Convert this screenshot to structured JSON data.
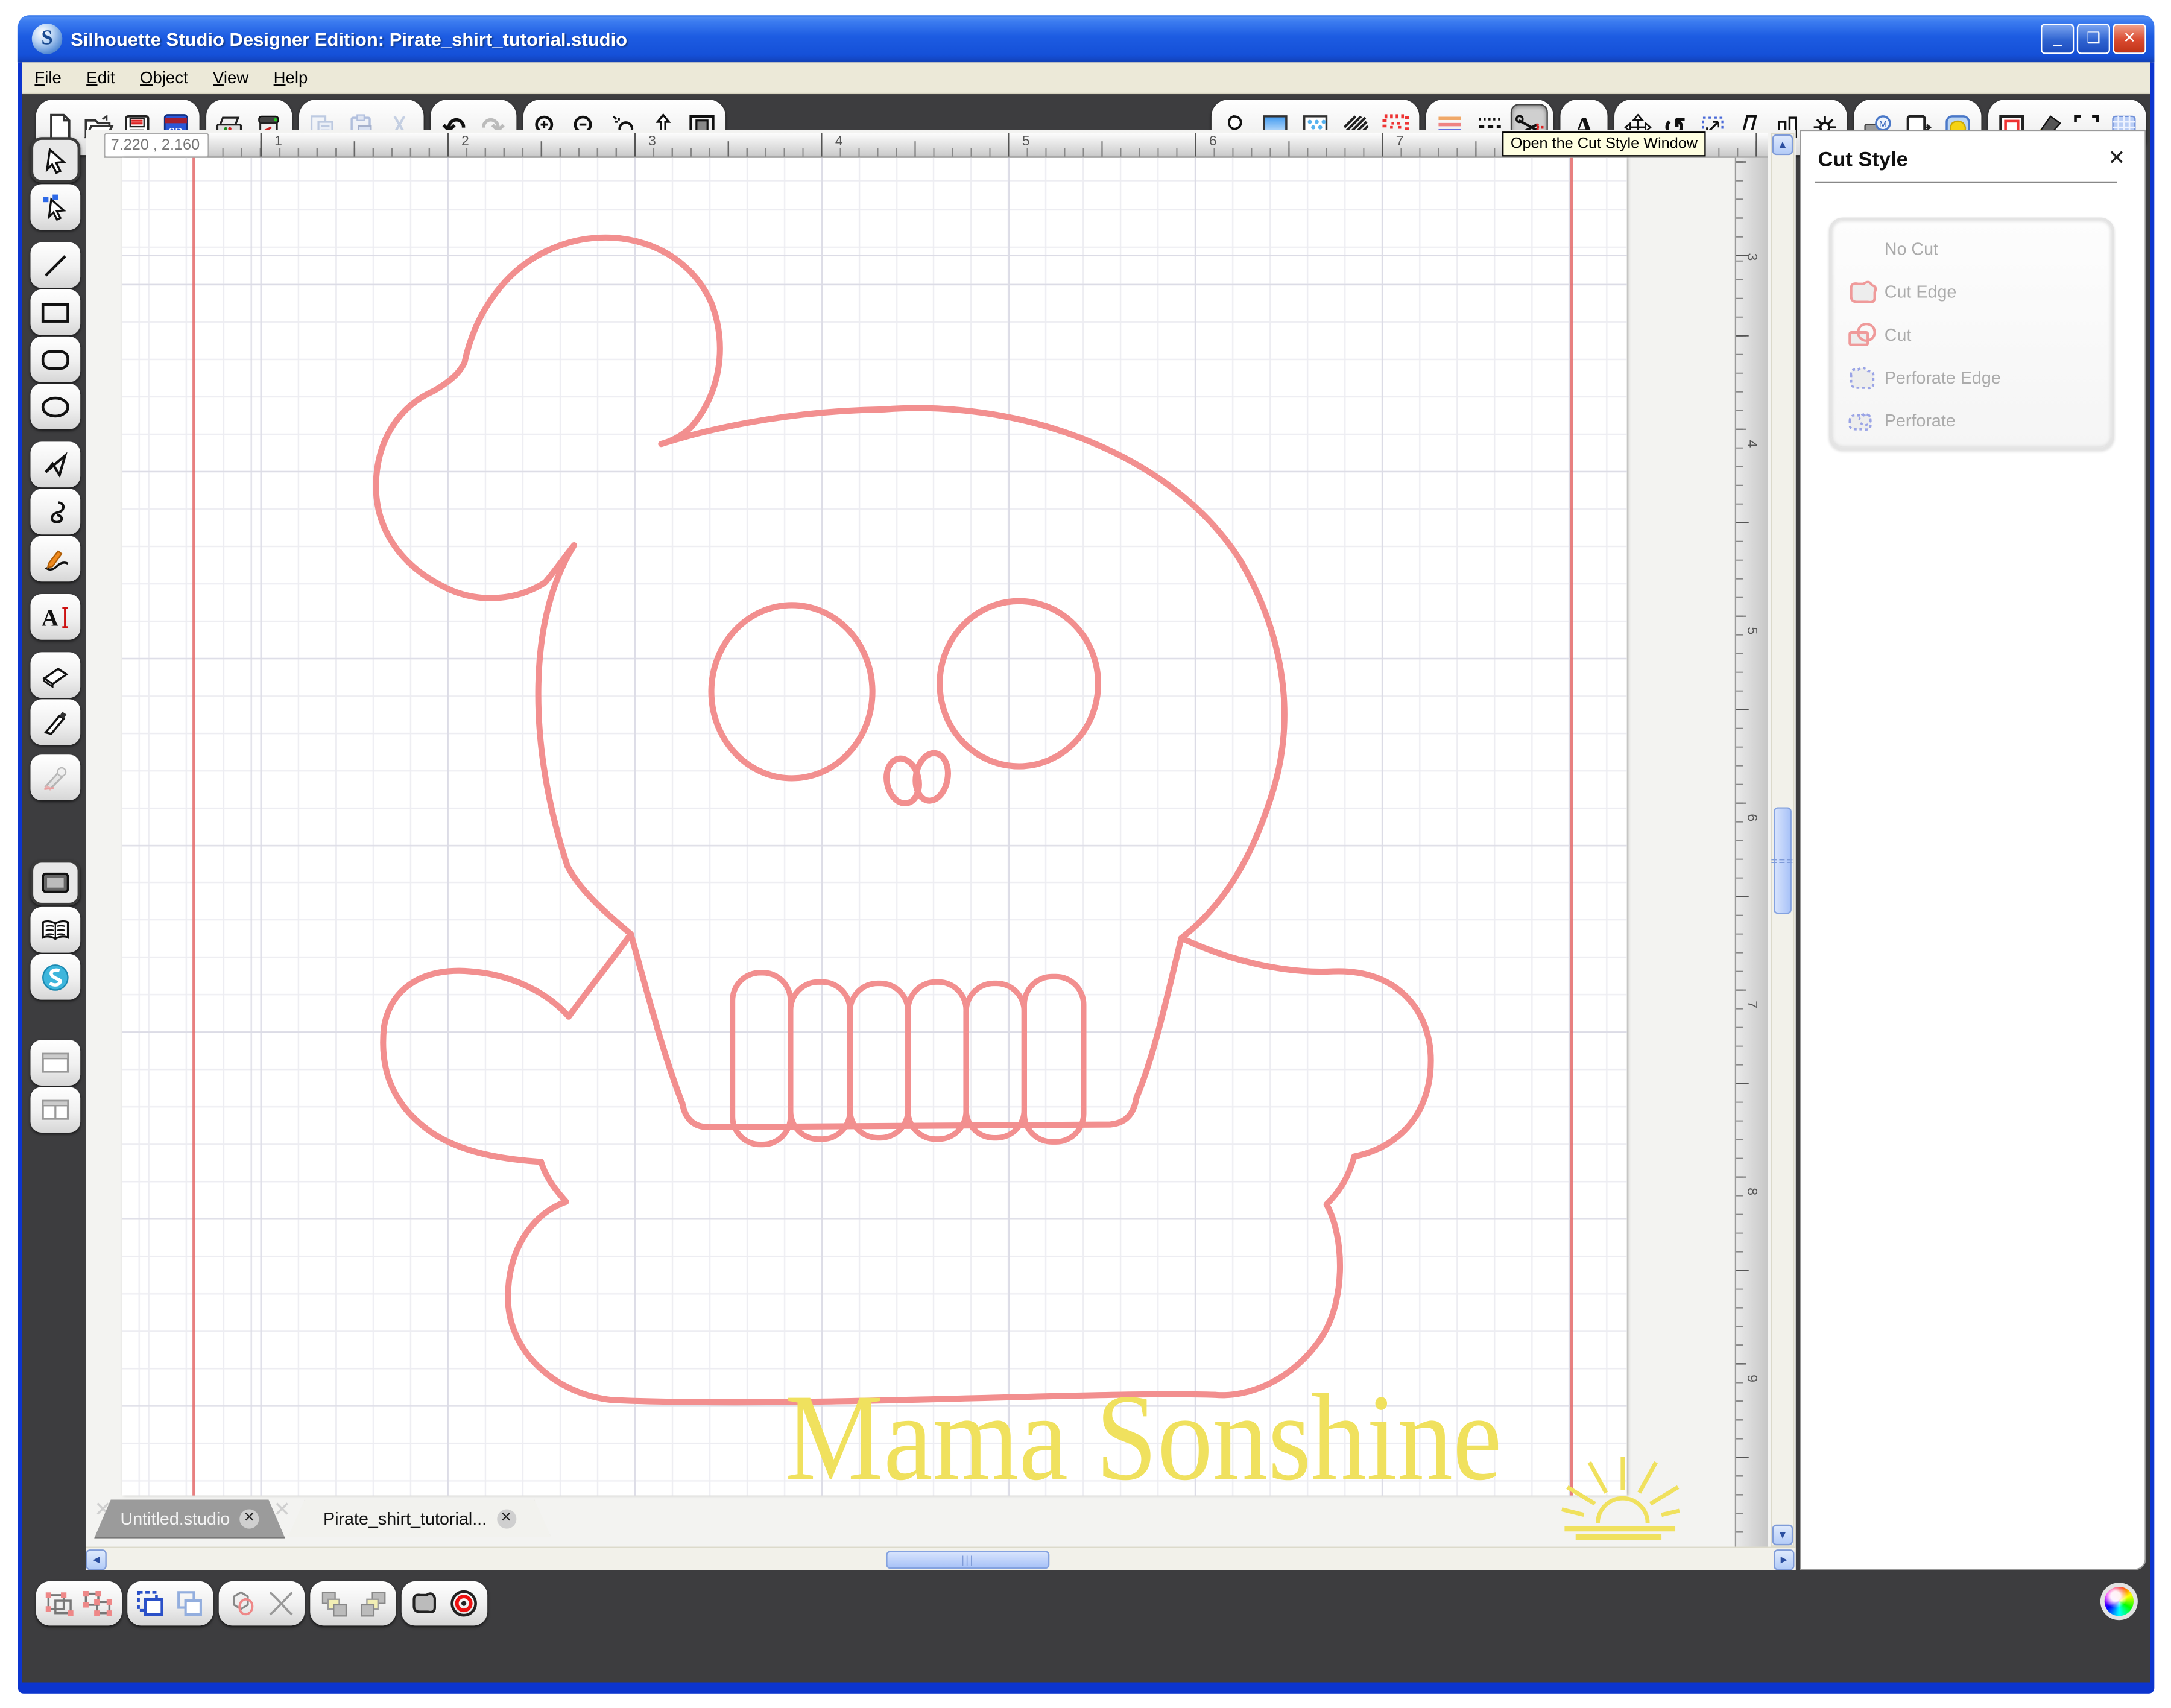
{
  "window": {
    "title": "Silhouette Studio Designer Edition: Pirate_shirt_tutorial.studio",
    "logo_letter": "S",
    "buttons": {
      "minimize": "_",
      "maximize": "❏",
      "close": "✕"
    }
  },
  "menu": {
    "items": [
      "File",
      "Edit",
      "Object",
      "View",
      "Help"
    ]
  },
  "top_toolbar": {
    "groups": [
      {
        "icons": [
          "new-document",
          "open",
          "save",
          "save-to-library"
        ]
      },
      {
        "icons": [
          "print",
          "send-to-silhouette"
        ]
      },
      {
        "icons": [
          "copy",
          "paste",
          "cut"
        ]
      },
      {
        "icons": [
          "undo",
          "redo"
        ]
      },
      {
        "icons": [
          "zoom-in",
          "zoom-out",
          "zoom-selection",
          "pan",
          "fit-to-page"
        ]
      },
      {
        "icons": [
          "fill-color",
          "fill-gradient",
          "fill-pattern",
          "shadow",
          "pattern-options"
        ]
      },
      {
        "icons": [
          "line-color",
          "line-style",
          "cut-style"
        ]
      },
      {
        "icons": [
          "text-style"
        ]
      },
      {
        "icons": [
          "move",
          "rotate",
          "scale",
          "shear",
          "align",
          "replicate"
        ]
      },
      {
        "icons": [
          "library",
          "page-settings",
          "modify"
        ]
      },
      {
        "icons": [
          "page-outline",
          "highlight",
          "trim-marks",
          "grid-settings"
        ]
      }
    ],
    "active_icon": "cut-style"
  },
  "tooltip": {
    "text": "Open the Cut Style Window"
  },
  "left_toolbar": {
    "tools": [
      "select",
      "edit-points",
      "line",
      "rectangle",
      "rounded-rectangle",
      "ellipse",
      "polygon",
      "curve",
      "freehand",
      "text",
      "eraser",
      "knife",
      "eyedropper",
      "page-tool",
      "library-view",
      "store",
      "single-window",
      "split-window"
    ],
    "active_tools": [
      "select",
      "page-tool"
    ]
  },
  "canvas": {
    "coordinates_readout": "7.220 , 2.160",
    "h_ruler_numbers": [
      "1",
      "2",
      "3",
      "4",
      "5",
      "6",
      "7"
    ],
    "v_ruler_numbers": [
      "3",
      "4",
      "5",
      "6",
      "7",
      "8",
      "9"
    ],
    "design": "skull-and-crossbones-outline",
    "design_stroke_color": "#f28f8f",
    "grid_minor_in": 0.2,
    "grid_major_in": 1.0,
    "margin_line_color": "#e46a6a"
  },
  "tabs": [
    {
      "label": "Untitled.studio",
      "close": "✕",
      "active": false
    },
    {
      "label": "Pirate_shirt_tutorial...",
      "close": "✕",
      "active": true
    }
  ],
  "cut_style_panel": {
    "title": "Cut Style",
    "close": "✕",
    "options": [
      {
        "label": "No Cut",
        "icon": "none"
      },
      {
        "label": "Cut Edge",
        "icon": "cut-edge-red-outline"
      },
      {
        "label": "Cut",
        "icon": "cut-red-outline"
      },
      {
        "label": "Perforate Edge",
        "icon": "perforate-edge-blue-dashed"
      },
      {
        "label": "Perforate",
        "icon": "perforate-blue-dashed"
      }
    ]
  },
  "bottom_toolbar": {
    "groups": [
      {
        "icons": [
          "group",
          "ungroup"
        ]
      },
      {
        "icons": [
          "make-compound-path",
          "release-compound-path"
        ]
      },
      {
        "icons": [
          "weld",
          "detach-lines"
        ]
      },
      {
        "icons": [
          "bring-to-front",
          "send-to-back"
        ]
      },
      {
        "icons": [
          "convert-to-path",
          "registration-marks"
        ]
      }
    ]
  },
  "watermark": {
    "text": "Mama Sonshine",
    "color": "#f0e15e"
  },
  "scrollbar_glyphs": {
    "up": "▲",
    "down": "▼",
    "left": "◄",
    "right": "►",
    "grip_v": "===",
    "grip_h": "|||"
  },
  "colors": {
    "titlebar_blue": "#1d5ce2",
    "app_background": "#3d3d3f",
    "menu_background": "#ece9d8",
    "design_pink": "#f28f8f",
    "watermark_yellow": "#f0e15e",
    "tooltip_background": "#ffffe1"
  }
}
